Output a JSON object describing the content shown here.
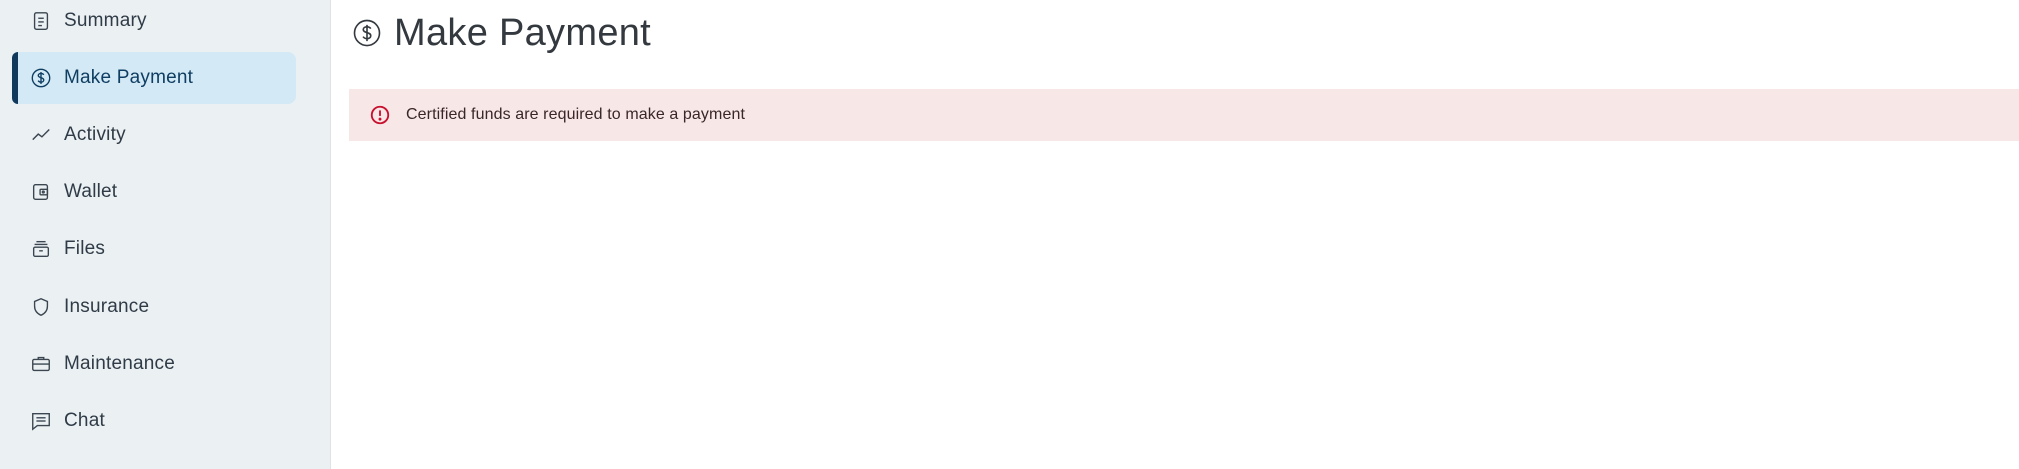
{
  "sidebar": {
    "items": [
      {
        "label": "Summary",
        "icon": "summary-icon"
      },
      {
        "label": "Make Payment",
        "icon": "dollar-circle-icon",
        "active": true
      },
      {
        "label": "Activity",
        "icon": "activity-icon"
      },
      {
        "label": "Wallet",
        "icon": "wallet-icon"
      },
      {
        "label": "Files",
        "icon": "files-icon"
      },
      {
        "label": "Insurance",
        "icon": "shield-icon"
      },
      {
        "label": "Maintenance",
        "icon": "briefcase-icon"
      },
      {
        "label": "Chat",
        "icon": "chat-icon"
      }
    ]
  },
  "main": {
    "title": "Make Payment",
    "title_icon": "dollar-circle-icon",
    "alert": {
      "message": "Certified funds are required to make a payment",
      "icon": "alert-circle-icon"
    }
  },
  "colors": {
    "sidebar_bg": "#ebf0f3",
    "active_bg": "#d3e9f5",
    "active_bar": "#10395c",
    "alert_bg": "#f7e7e7",
    "alert_icon": "#c8102e"
  }
}
